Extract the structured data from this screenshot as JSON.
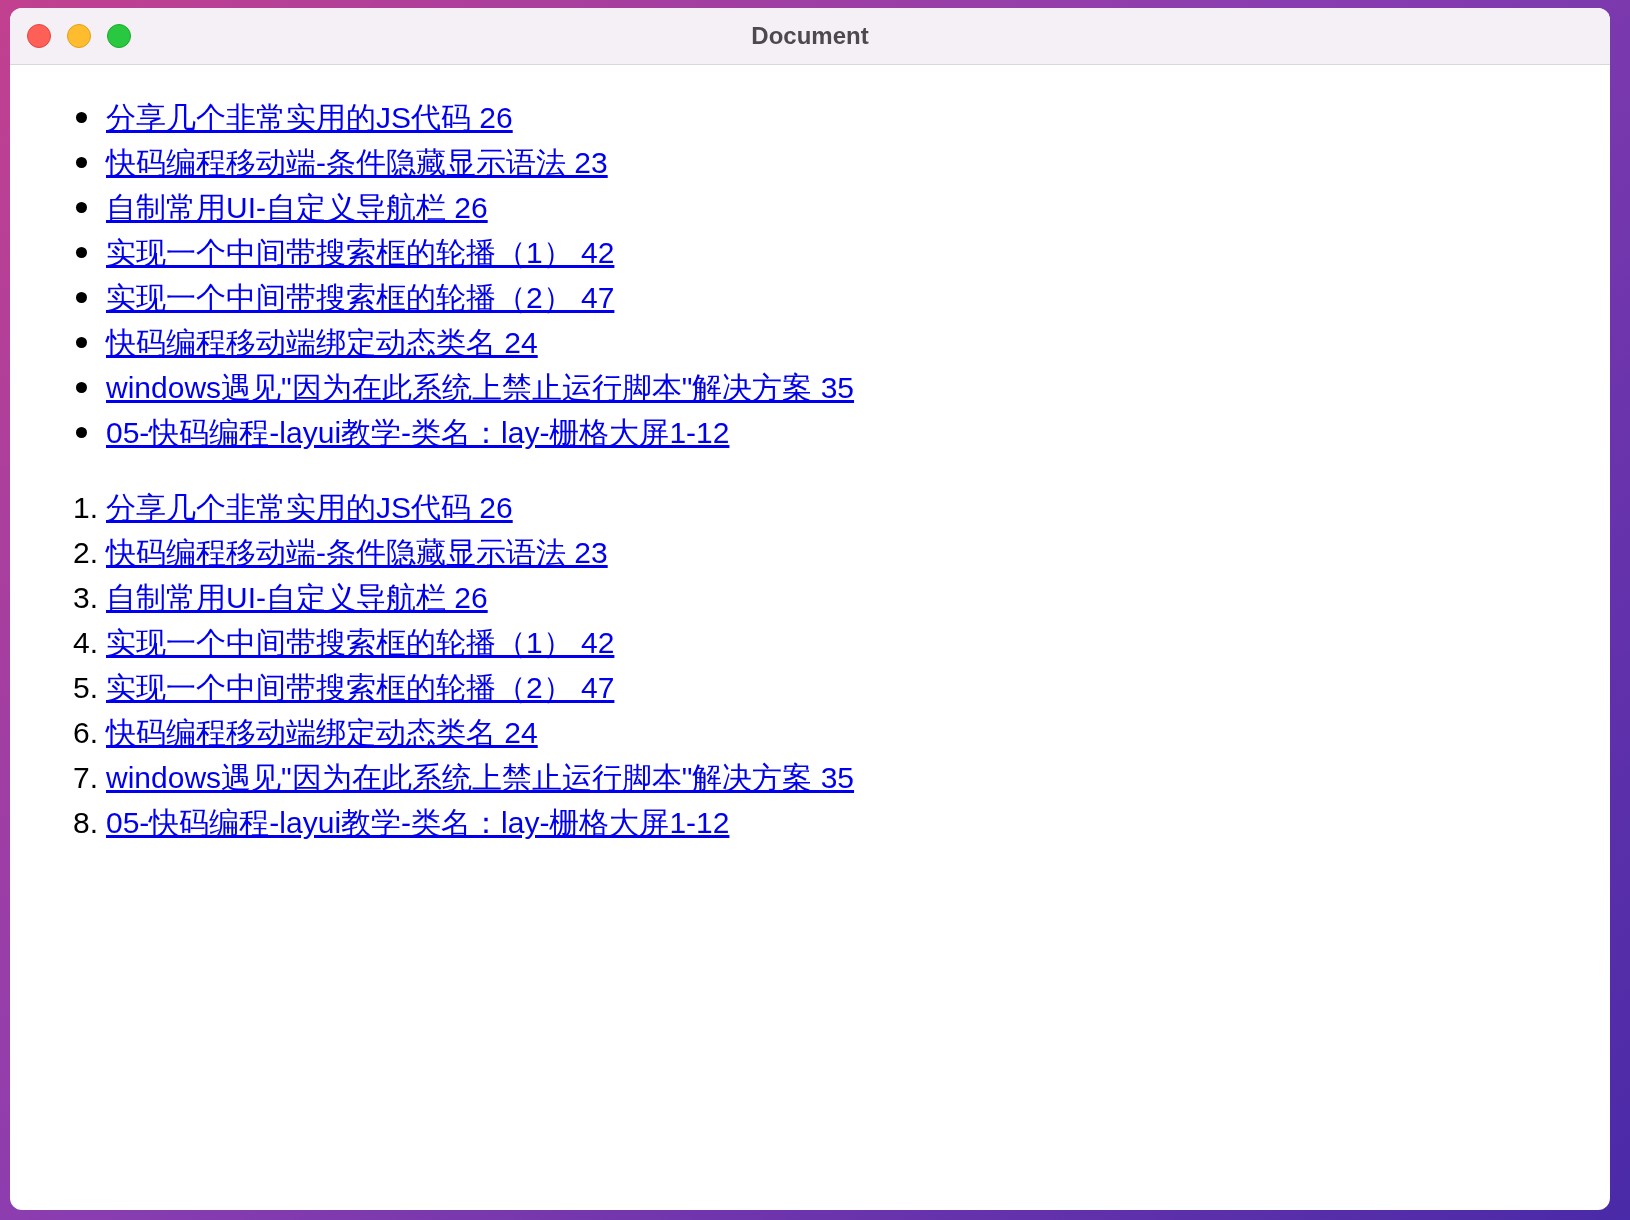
{
  "window": {
    "title": "Document"
  },
  "bullet_list": [
    {
      "text": "分享几个非常实用的JS代码 26"
    },
    {
      "text": "快码编程移动端-条件隐藏显示语法 23"
    },
    {
      "text": "自制常用UI-自定义导航栏 26"
    },
    {
      "text": "实现一个中间带搜索框的轮播（1） 42"
    },
    {
      "text": "实现一个中间带搜索框的轮播（2） 47"
    },
    {
      "text": "快码编程移动端绑定动态类名 24"
    },
    {
      "text": "windows遇见\"因为在此系统上禁止运行脚本\"解决方案 35"
    },
    {
      "text": "05-快码编程-layui教学-类名：lay-栅格大屏1-12"
    }
  ],
  "numbered_list": [
    {
      "marker": "1.",
      "text": "分享几个非常实用的JS代码 26"
    },
    {
      "marker": "2.",
      "text": "快码编程移动端-条件隐藏显示语法 23"
    },
    {
      "marker": "3.",
      "text": "自制常用UI-自定义导航栏 26"
    },
    {
      "marker": "4.",
      "text": "实现一个中间带搜索框的轮播（1） 42"
    },
    {
      "marker": "5.",
      "text": "实现一个中间带搜索框的轮播（2） 47"
    },
    {
      "marker": "6.",
      "text": "快码编程移动端绑定动态类名 24"
    },
    {
      "marker": "7.",
      "text": "windows遇见\"因为在此系统上禁止运行脚本\"解决方案 35"
    },
    {
      "marker": "8.",
      "text": "05-快码编程-layui教学-类名：lay-栅格大屏1-12"
    }
  ]
}
